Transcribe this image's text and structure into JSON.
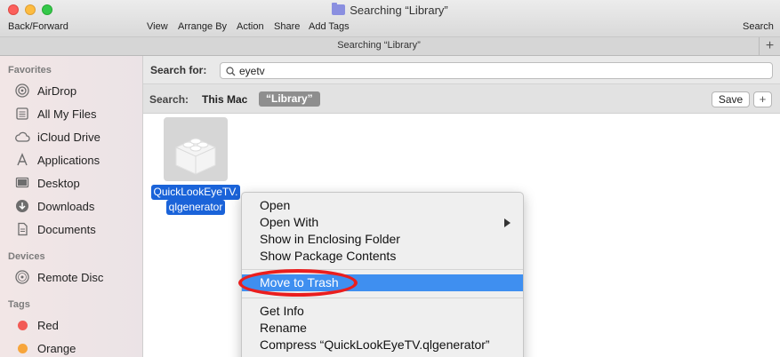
{
  "window": {
    "title": "Searching “Library”",
    "tab_title": "Searching “Library”",
    "tab_add": "+"
  },
  "toolbar": {
    "back_forward": "Back/Forward",
    "view": "View",
    "arrange_by": "Arrange By",
    "action": "Action",
    "share": "Share",
    "add_tags": "Add Tags",
    "search": "Search"
  },
  "sidebar": {
    "favorites_header": "Favorites",
    "favorites": [
      {
        "label": "AirDrop",
        "icon": "airdrop-icon"
      },
      {
        "label": "All My Files",
        "icon": "all-files-icon"
      },
      {
        "label": "iCloud Drive",
        "icon": "cloud-icon"
      },
      {
        "label": "Applications",
        "icon": "applications-icon"
      },
      {
        "label": "Desktop",
        "icon": "desktop-icon"
      },
      {
        "label": "Downloads",
        "icon": "downloads-icon"
      },
      {
        "label": "Documents",
        "icon": "documents-icon"
      }
    ],
    "devices_header": "Devices",
    "devices": [
      {
        "label": "Remote Disc",
        "icon": "disc-icon"
      }
    ],
    "tags_header": "Tags",
    "tags": [
      {
        "label": "Red",
        "color": "#f25a55"
      },
      {
        "label": "Orange",
        "color": "#f7a53b"
      }
    ]
  },
  "search": {
    "label": "Search for:",
    "value": "eyetv",
    "scope_label": "Search:",
    "scope_this_mac": "This Mac",
    "scope_library": "“Library”",
    "save_label": "Save",
    "add_label": "+"
  },
  "file": {
    "name_line1": "QuickLookEyeTV.",
    "name_line2": "qlgenerator"
  },
  "context_menu": {
    "items": [
      "Open",
      "Open With",
      "Show in Enclosing Folder",
      "Show Package Contents",
      "Move to Trash",
      "Get Info",
      "Rename",
      "Compress “QuickLookEyeTV.qlgenerator”"
    ]
  },
  "colors": {
    "highlight": "#3f8ff0",
    "annotation_circle": "#ea1e1e",
    "selection": "#1a63d9"
  }
}
